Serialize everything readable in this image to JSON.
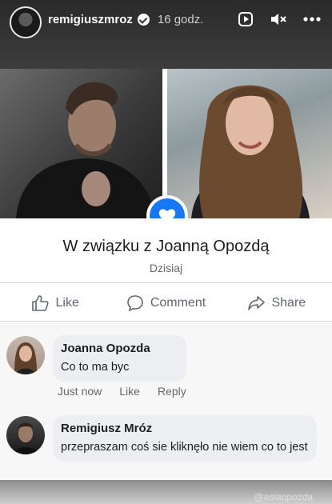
{
  "story": {
    "username": "remigiuszmroz",
    "time": "16 godz.",
    "icons": [
      "verified-badge-icon",
      "play-icon",
      "mute-icon",
      "more-icon"
    ]
  },
  "relationship": {
    "title": "W związku z  Joanną Opozdą",
    "date": "Dzisiaj",
    "badge_icon": "heart-icon",
    "badge_color": "#1877f2"
  },
  "actions": {
    "like": "Like",
    "comment": "Comment",
    "share": "Share"
  },
  "comments": [
    {
      "name": "Joanna Opozda",
      "text": "Co to ma byc",
      "meta": [
        "Just now",
        "Like",
        "Reply"
      ]
    },
    {
      "name": "Remigiusz Mróz",
      "text": "przepraszam coś sie kliknęło nie wiem co to jest"
    }
  ],
  "watermark": "@asiaopozda"
}
